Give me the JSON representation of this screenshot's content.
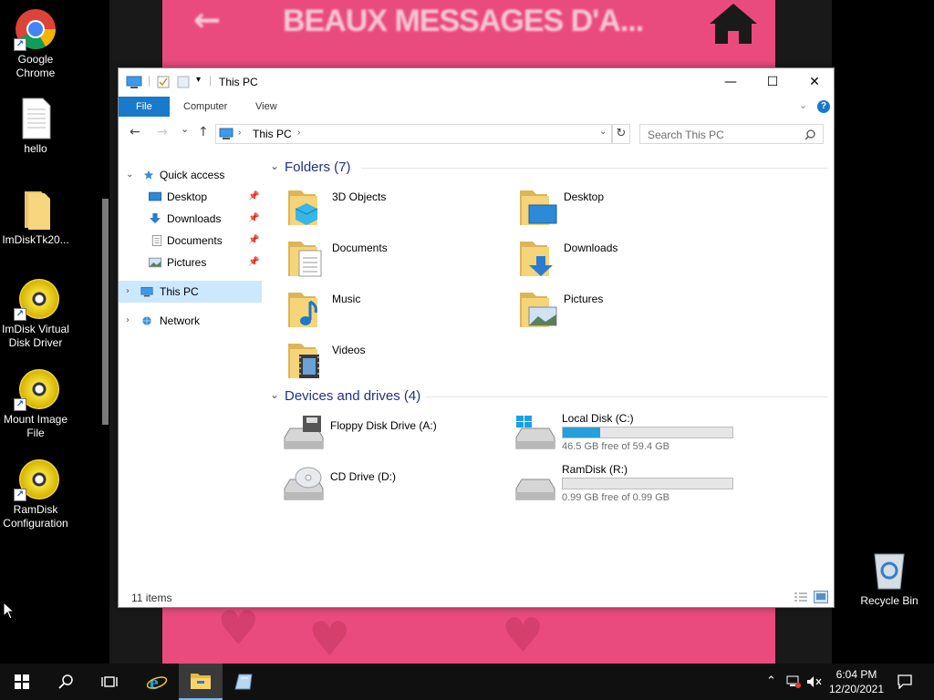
{
  "background": {
    "title": "BEAUX MESSAGES D'A...",
    "arrow": "←"
  },
  "desktop": {
    "icons": [
      {
        "label": "Google Chrome",
        "icon": "chrome-icon"
      },
      {
        "label": "hello",
        "icon": "text-document-icon"
      },
      {
        "label": "ImDiskTk20...",
        "icon": "folder-icon"
      },
      {
        "label": "ImDisk Virtual Disk Driver",
        "icon": "disc-icon"
      },
      {
        "label": "Mount Image File",
        "icon": "disc-icon"
      },
      {
        "label": "RamDisk Configuration",
        "icon": "disc-icon"
      }
    ],
    "recycle_bin": "Recycle Bin"
  },
  "window": {
    "title": "This PC",
    "controls": {
      "minimize": "—",
      "maximize": "☐",
      "close": "✕"
    },
    "ribbon": {
      "tabs": [
        "File",
        "Computer",
        "View"
      ]
    },
    "nav": {
      "back": "←",
      "forward": "→",
      "recent": "⌄",
      "up": "↑",
      "address": "This PC",
      "refresh": "↻",
      "search_placeholder": "Search This PC"
    },
    "navpane": {
      "quick_access": "Quick access",
      "pinned": [
        "Desktop",
        "Downloads",
        "Documents",
        "Pictures"
      ],
      "this_pc": "This PC",
      "network": "Network"
    },
    "folders_header": "Folders (7)",
    "folders": [
      "3D Objects",
      "Desktop",
      "Documents",
      "Downloads",
      "Music",
      "Pictures",
      "Videos"
    ],
    "devices_header": "Devices and drives (4)",
    "drives": [
      {
        "name": "Floppy Disk Drive (A:)"
      },
      {
        "name": "Local Disk (C:)",
        "free": "46.5 GB free of 59.4 GB",
        "used_fraction": 0.22
      },
      {
        "name": "CD Drive (D:)"
      },
      {
        "name": "RamDisk (R:)",
        "free": "0.99 GB free of 0.99 GB",
        "used_fraction": 0.0
      }
    ],
    "status": "11 items"
  },
  "taskbar": {
    "time": "6:04 PM",
    "date": "12/20/2021"
  },
  "colors": {
    "accent": "#1979ca",
    "selection": "#cce8ff",
    "drive_bar": "#26a0da",
    "section_header": "#1e3287"
  }
}
